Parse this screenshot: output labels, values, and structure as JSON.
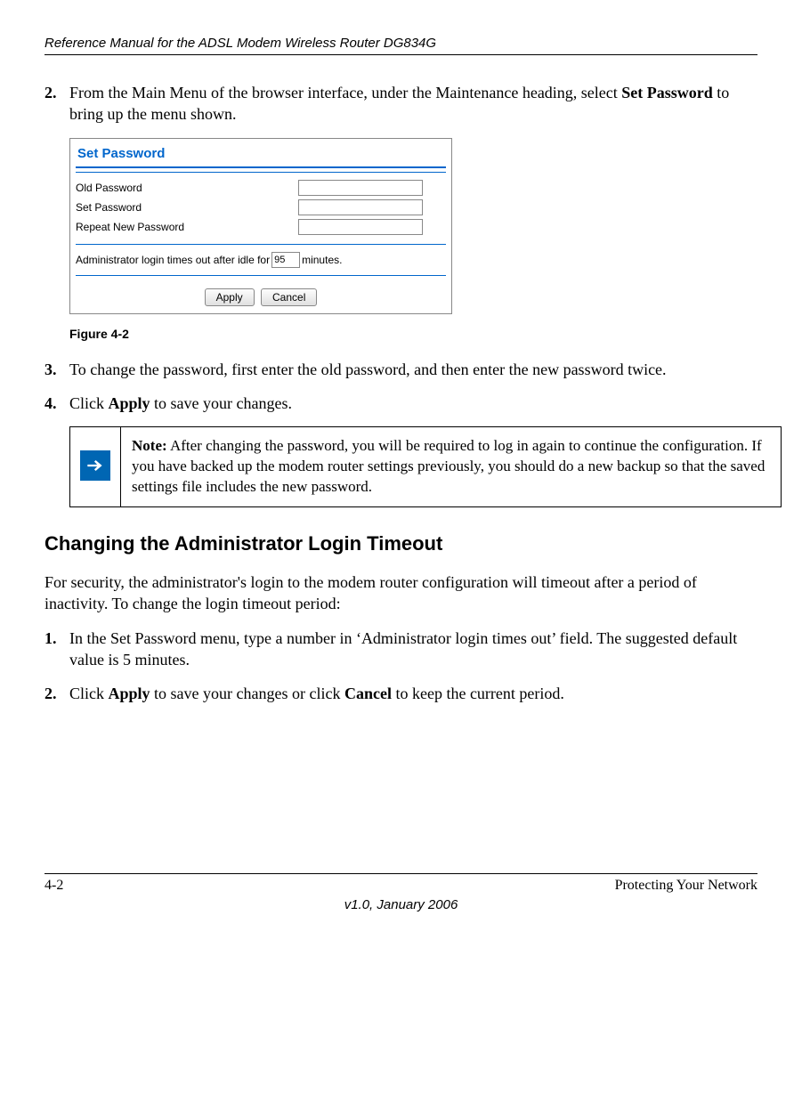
{
  "header": "Reference Manual for the ADSL Modem Wireless Router DG834G",
  "steps": {
    "s2_num": "2.",
    "s2_text_a": "From the Main Menu of the browser interface, under the Maintenance heading, select ",
    "s2_bold1": "Set Password",
    "s2_text_b": " to bring up the menu shown.",
    "s3_num": "3.",
    "s3_text": "To change the password, first enter the old password, and then enter the new password twice.",
    "s4_num": "4.",
    "s4_text_a": "Click ",
    "s4_bold": "Apply",
    "s4_text_b": " to save your changes."
  },
  "figure": {
    "title": "Set Password",
    "rows": {
      "old": "Old Password",
      "set": "Set Password",
      "repeat": "Repeat New Password"
    },
    "timeout_a": "Administrator login times out after idle for",
    "timeout_val": "95",
    "timeout_b": "minutes.",
    "apply": "Apply",
    "cancel": "Cancel",
    "caption": "Figure 4-2"
  },
  "note": {
    "label": "Note:",
    "text": " After changing the password, you will be required to log in again to continue the configuration. If you have backed up the modem router settings previously, you should do a new backup so that the saved settings file includes the new password."
  },
  "h2": "Changing the Administrator Login Timeout",
  "para1": "For security, the administrator's login to the modem router configuration will timeout after a period of inactivity. To change the login timeout period:",
  "list": {
    "l1_num": "1.",
    "l1_text": "In the Set Password menu, type a number in ‘Administrator login times out’ field. The suggested default value is 5 minutes.",
    "l2_num": "2.",
    "l2_a": "Click ",
    "l2_b1": "Apply",
    "l2_b": " to save your changes or click ",
    "l2_b2": "Cancel",
    "l2_c": " to keep the current period."
  },
  "footer": {
    "left": "4-2",
    "right": "Protecting Your Network",
    "center": "v1.0, January 2006"
  }
}
